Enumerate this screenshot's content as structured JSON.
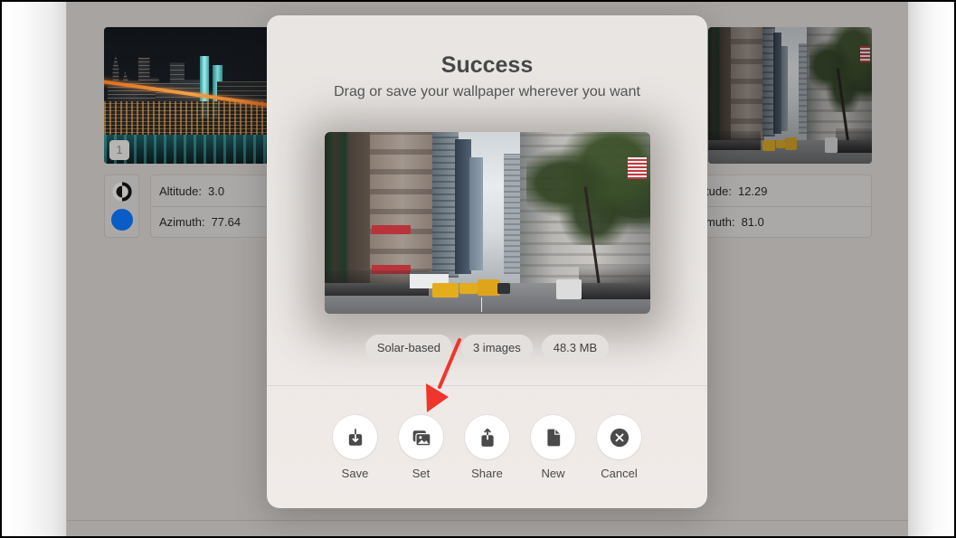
{
  "background_window": {
    "thumbnails": [
      {
        "subject": "night city skyline with bridge",
        "badge": "1"
      },
      {
        "subject": "city street with taxis"
      }
    ],
    "left_panel": {
      "mode_icon": "contrast-half-circle-icon",
      "swatch_color": "#0a5cc6",
      "altitude": {
        "label": "Altitude:",
        "value": "3.0"
      },
      "azimuth": {
        "label": "Azimuth:",
        "value": "77.64"
      }
    },
    "right_panel": {
      "altitude": {
        "label": "Altitude:",
        "value": "12.29"
      },
      "azimuth": {
        "label": "Azimuth:",
        "value": "81.0"
      }
    }
  },
  "dialog": {
    "title": "Success",
    "subtitle": "Drag or save your wallpaper wherever you want",
    "preview_subject": "city street wallpaper",
    "chips": [
      {
        "label": "Solar-based"
      },
      {
        "label": "3 images"
      },
      {
        "label": "48.3 MB"
      }
    ],
    "actions": [
      {
        "label": "Save",
        "icon": "save-download-icon"
      },
      {
        "label": "Set",
        "icon": "set-wallpaper-icon"
      },
      {
        "label": "Share",
        "icon": "share-icon"
      },
      {
        "label": "New",
        "icon": "new-document-icon"
      },
      {
        "label": "Cancel",
        "icon": "cancel-circle-x-icon"
      }
    ]
  },
  "annotation": {
    "type": "arrow",
    "points_to": "Set",
    "color": "#f0352d"
  },
  "colors": {
    "window_bg": "#a8a4a1",
    "dialog_bg": "#ebe7e4",
    "icon_dark": "#4a4a4a",
    "swatch_blue": "#0a5cc6",
    "arrow_red": "#f0352d"
  }
}
